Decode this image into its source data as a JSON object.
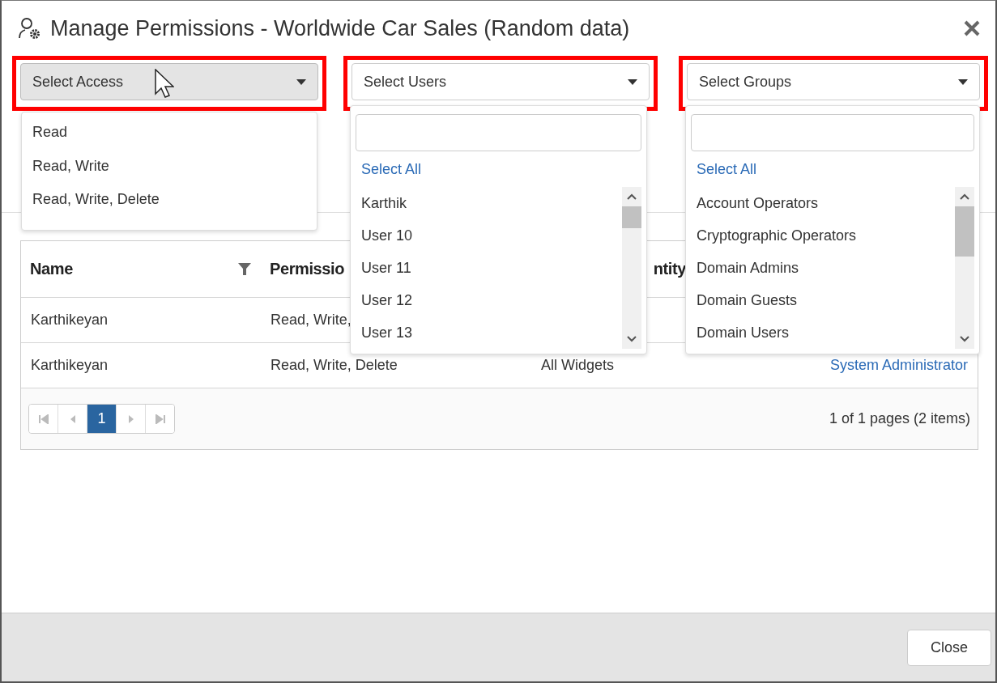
{
  "window": {
    "title": "Manage Permissions - Worldwide Car Sales (Random data)"
  },
  "filters": [
    {
      "kind": "access",
      "label": "Select Access",
      "focused": true,
      "expanded": true,
      "options": [
        "Read",
        "Read, Write",
        "Read, Write, Delete"
      ]
    },
    {
      "kind": "users",
      "label": "Select Users",
      "focused": false,
      "expanded": true,
      "select_all": "Select All",
      "options": [
        "Karthik",
        "User 10",
        "User 11",
        "User 12",
        "User 13"
      ]
    },
    {
      "kind": "groups",
      "label": "Select Groups",
      "focused": false,
      "expanded": true,
      "select_all": "Select All",
      "options": [
        "Account Operators",
        "Cryptographic Operators",
        "Domain Admins",
        "Domain Guests",
        "Domain Users"
      ]
    }
  ],
  "table": {
    "columns": [
      {
        "label": "Name",
        "filter": true,
        "kind": "text"
      },
      {
        "label": "Permissio",
        "filter": false,
        "kind": "text"
      },
      {
        "label": "ntity",
        "filter": false,
        "kind": "text"
      },
      {
        "kind": "link"
      }
    ],
    "rows": [
      {
        "cells": [
          "Karthikeyan",
          "Read, Write,"
        ]
      },
      {
        "cells": [
          "Karthikeyan",
          "Read, Write, Delete",
          "All Widgets",
          "System Administrator"
        ]
      }
    ]
  },
  "pager": {
    "pages": [
      {
        "label": "1",
        "selected": true
      }
    ],
    "info": "1 of 1 pages (2 items)"
  },
  "footer": {
    "buttons": [
      "Close"
    ]
  }
}
